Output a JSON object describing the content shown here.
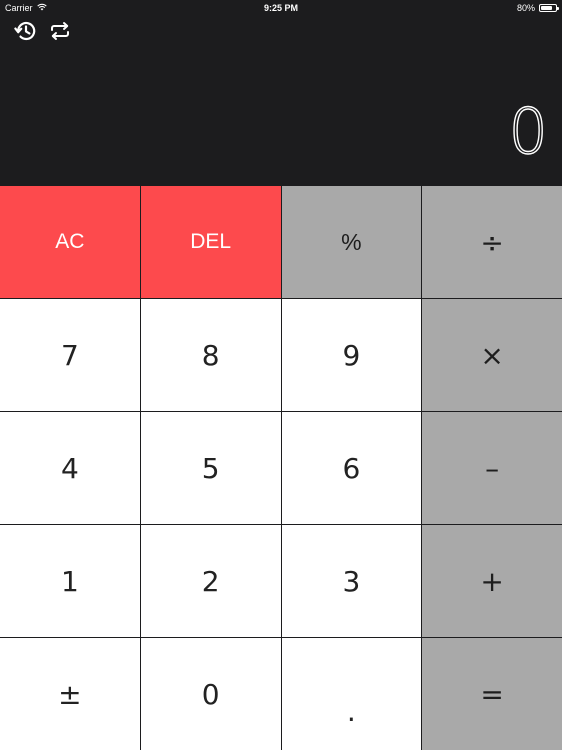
{
  "status_bar": {
    "carrier": "Carrier",
    "time": "9:25 PM",
    "battery": "80%",
    "battery_level": 0.8
  },
  "toolbar": {
    "history_icon": "history-icon",
    "convert_icon": "repeat-icon"
  },
  "display": {
    "value": "0"
  },
  "keys": [
    {
      "label": "AC",
      "style": "red"
    },
    {
      "label": "DEL",
      "style": "red"
    },
    {
      "label": "%",
      "style": "grey"
    },
    {
      "label": "÷",
      "style": "grey"
    },
    {
      "label": "7",
      "style": "white"
    },
    {
      "label": "8",
      "style": "white"
    },
    {
      "label": "9",
      "style": "white"
    },
    {
      "label": "×",
      "style": "grey"
    },
    {
      "label": "4",
      "style": "white"
    },
    {
      "label": "5",
      "style": "white"
    },
    {
      "label": "6",
      "style": "white"
    },
    {
      "label": "–",
      "style": "grey"
    },
    {
      "label": "1",
      "style": "white"
    },
    {
      "label": "2",
      "style": "white"
    },
    {
      "label": "3",
      "style": "white"
    },
    {
      "label": "+",
      "style": "grey"
    },
    {
      "label": "±",
      "style": "white"
    },
    {
      "label": "0",
      "style": "white"
    },
    {
      "label": ".",
      "style": "white"
    },
    {
      "label": "=",
      "style": "grey"
    }
  ],
  "colors": {
    "background": "#1c1c1e",
    "clear_keys": "#fd4a4d",
    "operator_keys": "#a9a9a9",
    "digit_keys": "#ffffff"
  }
}
